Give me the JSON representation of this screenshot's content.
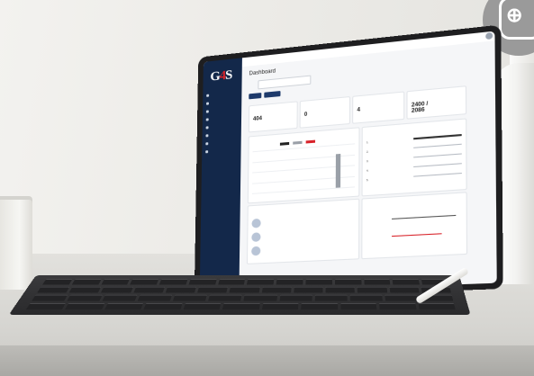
{
  "scene": {
    "colors": {
      "wall": "#eeede9",
      "desk": "#d9d8d4",
      "sidebar": "#13284a",
      "accent_red": "#d8232a",
      "button": "#1e3a6b"
    }
  },
  "app": {
    "logo": "G4S",
    "page_title": "Dashboard",
    "user_label": "",
    "sidebar": {
      "items": [
        {
          "label": "",
          "icon": "dashboard-icon"
        },
        {
          "label": "",
          "icon": "users-icon"
        },
        {
          "label": "",
          "icon": "document-icon"
        },
        {
          "label": "",
          "icon": "list-icon"
        },
        {
          "label": "",
          "icon": "settings-icon"
        },
        {
          "label": "",
          "icon": "bell-icon"
        },
        {
          "label": "",
          "icon": "folder-icon"
        },
        {
          "label": "",
          "icon": "chart-icon"
        }
      ]
    },
    "filter": {
      "label": "",
      "placeholder": "",
      "button_primary": "",
      "button_secondary": ""
    },
    "stat_cards": [
      {
        "label": "",
        "value": "404",
        "value2": ""
      },
      {
        "label": "",
        "value": "0",
        "value2": ""
      },
      {
        "label": "",
        "value": "4",
        "value2": ""
      },
      {
        "label": "",
        "value": "2400 /",
        "value2": "2086"
      }
    ],
    "chart_panel": {
      "title": ""
    },
    "ranking_panel": {
      "title": "",
      "rows": [
        {
          "num": "1.",
          "name": ""
        },
        {
          "num": "2.",
          "name": ""
        },
        {
          "num": "3.",
          "name": ""
        },
        {
          "num": "4.",
          "name": ""
        },
        {
          "num": "5.",
          "name": ""
        }
      ]
    },
    "branches_panel": {
      "title": "",
      "items": [
        {
          "name": "",
          "id": ""
        },
        {
          "name": "",
          "id": ""
        },
        {
          "name": "",
          "id": ""
        }
      ]
    },
    "activity_panel": {
      "title": ""
    }
  }
}
